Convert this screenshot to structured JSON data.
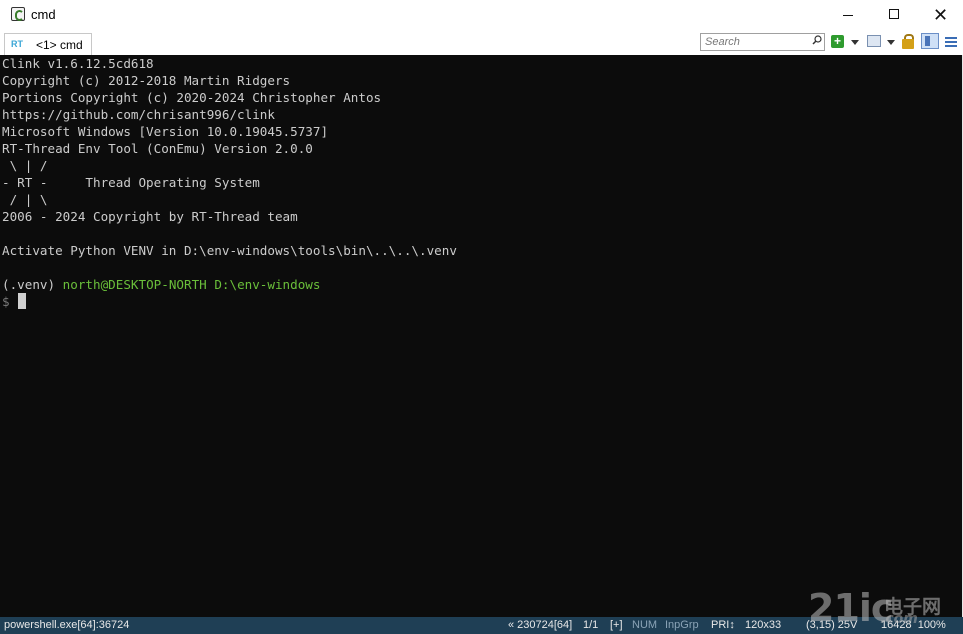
{
  "window": {
    "title": "cmd",
    "controls": {
      "minimize": "─",
      "maximize": "☐",
      "close": "✕"
    }
  },
  "tabs": [
    {
      "label": "<1> cmd",
      "icon": "rt-thread-icon",
      "icon_text": "RT"
    }
  ],
  "search": {
    "placeholder": "Search"
  },
  "toolbar": {
    "icons": [
      "add-console-icon",
      "dropdown-arrow-icon",
      "window-icon",
      "dropdown-arrow-icon",
      "lock-icon",
      "panel-toggle-icon",
      "menu-icon"
    ],
    "add_glyph": "+"
  },
  "console": {
    "lines": [
      "Clink v1.6.12.5cd618",
      "Copyright (c) 2012-2018 Martin Ridgers",
      "Portions Copyright (c) 2020-2024 Christopher Antos",
      "https://github.com/chrisant996/clink",
      "Microsoft Windows [Version 10.0.19045.5737]",
      "RT-Thread Env Tool (ConEmu) Version 2.0.0",
      " \\ | /",
      "- RT -     Thread Operating System",
      " / | \\",
      "2006 - 2024 Copyright by RT-Thread team",
      "",
      "Activate Python VENV in D:\\env-windows\\tools\\bin\\..\\..\\.venv",
      ""
    ],
    "prompt": {
      "venv": "(.venv) ",
      "user_host": "north@DESKTOP-NORTH",
      "path": " D:\\env-windows",
      "symbol": "$ "
    },
    "colors": {
      "background": "#0c0c0c",
      "text": "#cccccc",
      "prompt_green": "#6abf3a"
    }
  },
  "statusbar": {
    "process": "powershell.exe[64]:36724",
    "build": "« 230724[64]",
    "console_index": "1/1",
    "plus": "[+]",
    "num": "NUM",
    "inpgrp": "InpGrp",
    "pri": "PRI↕",
    "size": "120x33",
    "cursor": "(3,15) 25V",
    "pid_zoom": "16428  100%"
  },
  "watermark": {
    "text": "21ic",
    "cn": "电子网",
    "com": ".com"
  }
}
